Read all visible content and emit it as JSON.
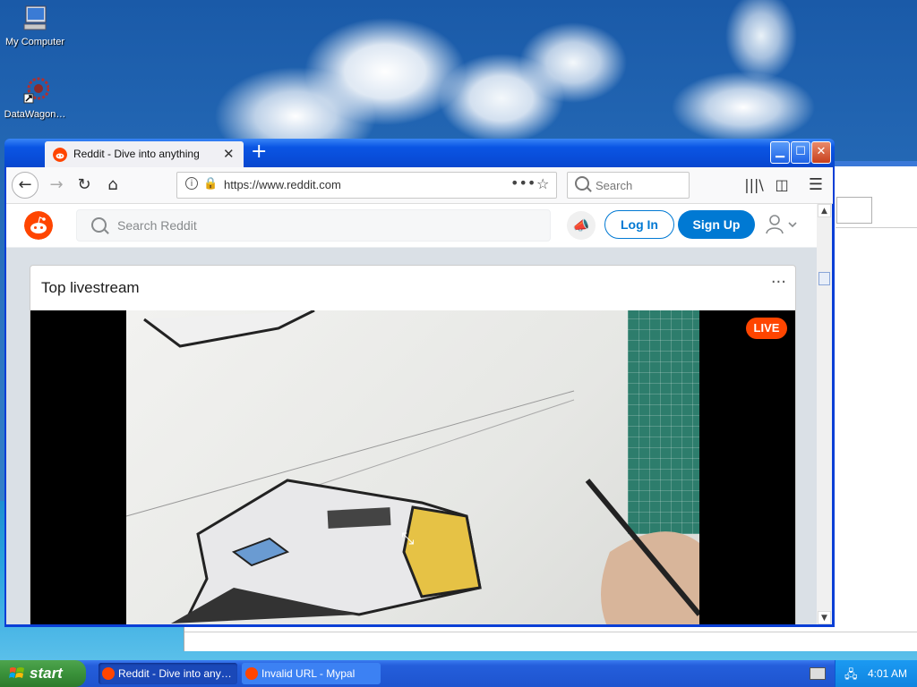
{
  "desktop": {
    "icons": [
      {
        "label": "My Computer",
        "icon": "computer-icon"
      },
      {
        "label": "DataWagon…",
        "icon": "datawagon-icon"
      }
    ]
  },
  "browser": {
    "tab": {
      "title": "Reddit - Dive into anything",
      "favicon": "reddit-icon"
    },
    "toolbar": {
      "url": "https://www.reddit.com",
      "search_placeholder": "Search"
    }
  },
  "reddit": {
    "search_placeholder": "Search Reddit",
    "login_label": "Log In",
    "signup_label": "Sign Up",
    "card": {
      "title": "Top livestream",
      "more_label": "···",
      "live_badge": "LIVE"
    }
  },
  "taskbar": {
    "start_label": "start",
    "tasks": [
      {
        "label": "Reddit - Dive into any…",
        "active": true
      },
      {
        "label": "Invalid URL - Mypal",
        "active": false
      }
    ],
    "clock": "4:01 AM"
  },
  "colors": {
    "reddit_orange": "#ff4500",
    "reddit_blue": "#0079d3",
    "xp_title_blue": "#0a55e4",
    "xp_start_green": "#3a913a"
  }
}
